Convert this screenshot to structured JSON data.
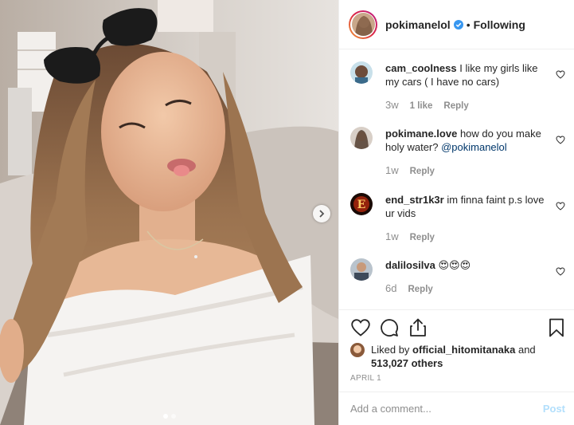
{
  "header": {
    "username": "pokimanelol",
    "separator": "•",
    "follow_label": "Following",
    "verified_icon": "verified-badge-icon"
  },
  "comments": [
    {
      "user": "cam_coolness",
      "text": "I like my girls like my cars ( I have no cars)",
      "time": "3w",
      "likes": "1 like",
      "reply": "Reply"
    },
    {
      "user": "pokimane.love",
      "text": "how do you make holy water? ",
      "mention": "@pokimanelol",
      "time": "1w",
      "reply": "Reply"
    },
    {
      "user": "end_str1k3r",
      "text": "im finna faint p.s love ur vids",
      "time": "1w",
      "reply": "Reply"
    },
    {
      "user": "dalilosilva",
      "text": "😍😍😍",
      "time": "6d",
      "reply": "Reply"
    }
  ],
  "likes": {
    "prefix": "Liked by ",
    "user": "official_hitomitanaka",
    "middle": " and",
    "count": "513,027 others"
  },
  "date": "APRIL 1",
  "add_comment": {
    "placeholder": "Add a comment...",
    "post_label": "Post"
  },
  "carousel": {
    "slide_count": 2,
    "active_slide": 1
  },
  "colors": {
    "mention": "#00376b",
    "verified": "#3897f0",
    "post_disabled": "#b2dffc",
    "muted": "#8e8e8e"
  }
}
